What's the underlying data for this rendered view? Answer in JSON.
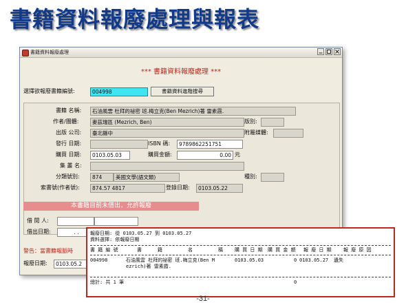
{
  "slide": {
    "title": "書籍資料報廢處理與報表",
    "page_number": "-31-"
  },
  "window": {
    "title": "書籍資料報廢處理",
    "header": "***  書籍資料報廢處理  ***"
  },
  "search": {
    "label": "選擇欲報廢書籍編號:",
    "value": "004998",
    "button": "書籍資料進階搜尋"
  },
  "book": {
    "title_label": "書籍 名稱:",
    "title": "石油風雲 杜拜的祕密 班.梅立克(Ben Mezrich)著 雷素霞.",
    "author_label": "作者/團體:",
    "author": "麥茲瑞區 (Mezrich, Ben)",
    "edition_label": "版別:",
    "edition": "",
    "publisher_label": "出版 公司:",
    "publisher": "臺北縣中",
    "media_label": "附屬媒體:",
    "media": "",
    "issue_date_label": "發行 日期:",
    "issue_date": "",
    "isbn_label": "ISBN  碼:",
    "isbn": "9789862251751",
    "purchase_date_label": "購買 日期:",
    "purchase_date": "0103.05.03",
    "price_label": "購買金額:",
    "price": "0.00",
    "price_unit": "元",
    "series_label": "集 叢 名:",
    "series": "",
    "class_label": "分類號別:",
    "class_code": "874",
    "class_name": "美國文學(語文類)",
    "type_label": "種別:",
    "type_value": "",
    "call_label": "索書號(作者號):",
    "call_number": "874.57 4817",
    "reg_label": "登錄日期:",
    "reg_date": "0103.05.22"
  },
  "status": {
    "banner": "本書籍目前未借出，允許報廢",
    "borrower_label": "借 閱 人:",
    "borrow_date_label": "借出日期:",
    "borrow_date": ".      .",
    "warning": "警告：當書籍報脈時",
    "scrap_date_label": "報廢日期:",
    "scrap_date": "0103.05.2"
  },
  "report": {
    "date_line": "報廢日期: 從 0103.05.27 到 0103.05.27",
    "select_line": "資料選擇: 依報廢日期",
    "headers": [
      "書 籍 編 號",
      "書",
      "籍",
      "名",
      "稱",
      "購 買 日 期",
      "購 買 金 額",
      "報 廢 日 期",
      "報 廢 原 因"
    ],
    "rows": [
      {
        "id": "004998",
        "name_line1": "石油風雲 杜拜的祕密 班.梅立克(Ben M",
        "name_line2": "ezrich)著 雷素霞.",
        "purchase_date": "0103.05.03",
        "amount": "0",
        "scrap_date": "0103.05.27",
        "reason": "遺失"
      }
    ],
    "total_label": "總計: 共 1 筆",
    "total_amount": "0"
  }
}
